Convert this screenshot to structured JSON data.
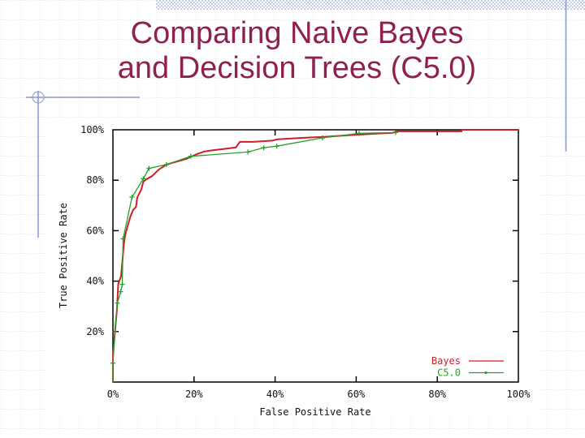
{
  "slide": {
    "title_lines": [
      "Comparing Naive Bayes",
      "and Decision Trees (C5.0)"
    ]
  },
  "colors": {
    "title": "#8e2150",
    "decoration": "#8a96c8",
    "grid": "#c9d1e3",
    "checker": "#c5d0ea",
    "axis": "#000000"
  },
  "chart_data": {
    "type": "line",
    "title": "",
    "xlabel": "False Positive Rate",
    "ylabel": "True Positive Rate",
    "xlim": [
      0,
      100
    ],
    "ylim": [
      0,
      100
    ],
    "xticks": [
      0,
      20,
      40,
      60,
      80,
      100
    ],
    "xtick_labels": [
      "0%",
      "20%",
      "40%",
      "60%",
      "80%",
      "100%"
    ],
    "yticks": [
      20,
      40,
      60,
      80,
      100
    ],
    "ytick_labels": [
      "20%",
      "40%",
      "60%",
      "80%",
      "100%"
    ],
    "grid": false,
    "legend": {
      "position": "bottom-right",
      "entries": [
        {
          "label": "Bayes",
          "series": 0
        },
        {
          "label": "C5.0",
          "series": 1
        }
      ]
    },
    "series": [
      {
        "name": "Bayes",
        "color": "#cc1f2a",
        "markers": false,
        "points": [
          [
            0,
            0
          ],
          [
            0,
            9.7
          ],
          [
            0.3,
            16.1
          ],
          [
            1.0,
            29.0
          ],
          [
            1.3,
            38.7
          ],
          [
            2.0,
            41.9
          ],
          [
            2.7,
            54.8
          ],
          [
            3.0,
            58.1
          ],
          [
            3.7,
            62.4
          ],
          [
            4.3,
            65.6
          ],
          [
            5.0,
            68.3
          ],
          [
            5.7,
            69.4
          ],
          [
            6.0,
            73.1
          ],
          [
            7.0,
            76.3
          ],
          [
            7.5,
            79.4
          ],
          [
            8.3,
            80.4
          ],
          [
            9.7,
            81.7
          ],
          [
            11.3,
            84.2
          ],
          [
            13.0,
            86.0
          ],
          [
            14.0,
            86.6
          ],
          [
            18.0,
            88.4
          ],
          [
            20.6,
            90.3
          ],
          [
            22.6,
            91.4
          ],
          [
            24.6,
            91.9
          ],
          [
            28.0,
            92.5
          ],
          [
            30.3,
            93.0
          ],
          [
            31.3,
            95.2
          ],
          [
            34.6,
            95.2
          ],
          [
            39.3,
            95.7
          ],
          [
            40.6,
            96.2
          ],
          [
            46.6,
            96.8
          ],
          [
            52.0,
            97.2
          ],
          [
            58.0,
            97.8
          ],
          [
            65.0,
            98.5
          ],
          [
            69.0,
            98.8
          ],
          [
            70.0,
            99.4
          ],
          [
            86.0,
            99.4
          ],
          [
            86.0,
            100
          ],
          [
            100,
            100
          ]
        ]
      },
      {
        "name": "C5.0",
        "color": "#2a9e2a",
        "markers": true,
        "points": [
          [
            0,
            0
          ],
          [
            0,
            7.5
          ],
          [
            0.5,
            19.9
          ],
          [
            1.1,
            31.3
          ],
          [
            1.9,
            35.8
          ],
          [
            2.3,
            38.7
          ],
          [
            2.5,
            56.8
          ],
          [
            4.7,
            73.3
          ],
          [
            7.5,
            80.6
          ],
          [
            8.9,
            84.7
          ],
          [
            13.2,
            86.2
          ],
          [
            19.2,
            89.5
          ],
          [
            33.3,
            91.2
          ],
          [
            37.2,
            92.9
          ],
          [
            40.4,
            93.5
          ],
          [
            51.7,
            96.8
          ],
          [
            60.7,
            98.6
          ],
          [
            69.7,
            98.9
          ]
        ]
      }
    ]
  }
}
